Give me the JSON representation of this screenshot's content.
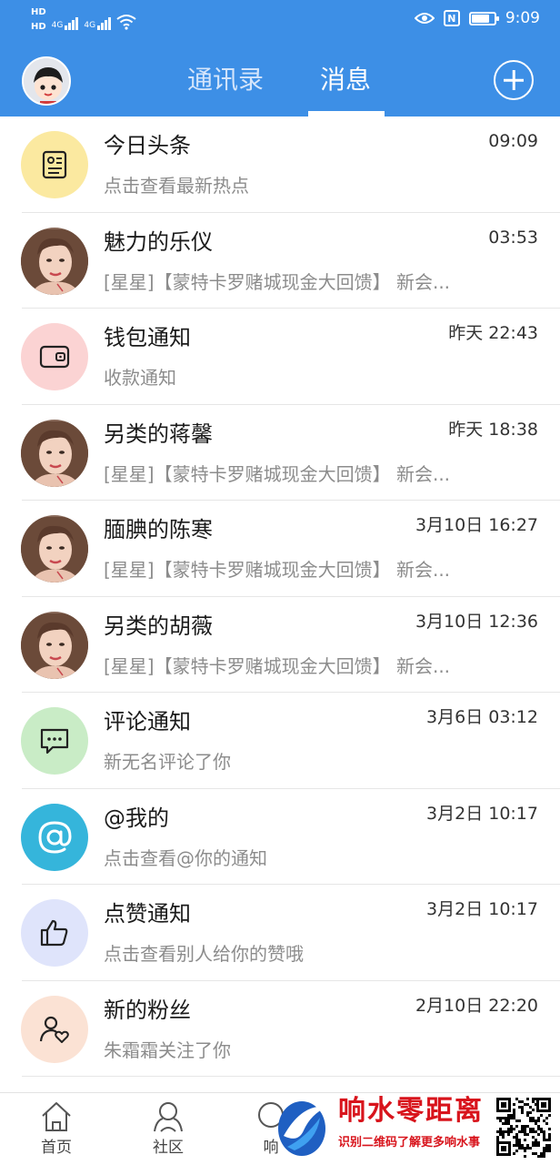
{
  "status_bar": {
    "hd1": "HD",
    "hd2": "HD",
    "net1": "4G",
    "net2": "4G",
    "nfc": "N",
    "time": "9:09",
    "battery_level": 0.8
  },
  "header": {
    "tab_contacts": "通讯录",
    "tab_messages": "消息",
    "active_tab": "消息",
    "accent": "#3d8fe6"
  },
  "messages": [
    {
      "name": "今日头条",
      "time": "09:09",
      "preview": "点击查看最新热点",
      "icon": "news-icon",
      "bg": "#fbe9a0"
    },
    {
      "name": "魅力的乐仪",
      "time": "03:53",
      "preview": "[星星]【蒙特卡罗赌城现金大回馈】 新会...",
      "icon": "user-photo-avatar"
    },
    {
      "name": "钱包通知",
      "time": "昨天 22:43",
      "preview": "收款通知",
      "icon": "wallet-icon",
      "bg": "#fbd3d3"
    },
    {
      "name": "另类的蒋馨",
      "time": "昨天 18:38",
      "preview": "[星星]【蒙特卡罗赌城现金大回馈】 新会...",
      "icon": "user-photo-avatar"
    },
    {
      "name": "腼腆的陈寒",
      "time": "3月10日 16:27",
      "preview": "[星星]【蒙特卡罗赌城现金大回馈】 新会...",
      "icon": "user-photo-avatar"
    },
    {
      "name": "另类的胡薇",
      "time": "3月10日 12:36",
      "preview": "[星星]【蒙特卡罗赌城现金大回馈】 新会...",
      "icon": "user-photo-avatar"
    },
    {
      "name": "评论通知",
      "time": "3月6日 03:12",
      "preview": "新无名评论了你",
      "icon": "comment-icon",
      "bg": "#c9ecc6"
    },
    {
      "name": "@我的",
      "time": "3月2日 10:17",
      "preview": "点击查看@你的通知",
      "icon": "at-icon",
      "bg": "#35b5db"
    },
    {
      "name": "点赞通知",
      "time": "3月2日 10:17",
      "preview": "点击查看别人给你的赞哦",
      "icon": "thumbs-up-icon",
      "bg": "#dfe4fb"
    },
    {
      "name": "新的粉丝",
      "time": "2月10日 22:20",
      "preview": "朱霜霜关注了你",
      "icon": "follower-icon",
      "bg": "#fbe2d4"
    }
  ],
  "bottom_nav": {
    "home": "首页",
    "community": "社区",
    "msg_partial": "响"
  },
  "watermark": {
    "title": "响水零距离",
    "subtitle": "识别二维码了解更多响水事",
    "color": "#d8141c"
  }
}
